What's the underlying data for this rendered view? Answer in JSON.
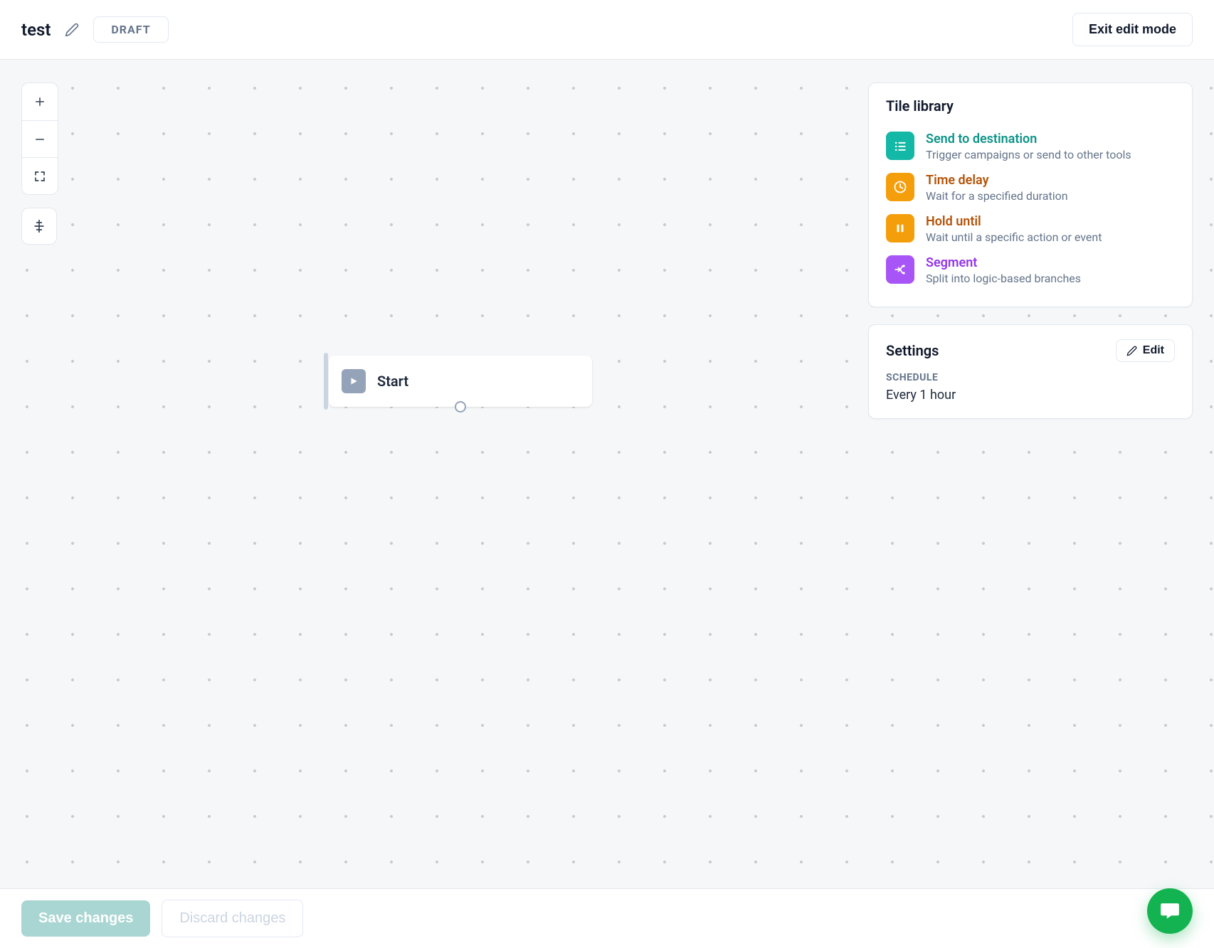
{
  "header": {
    "title": "test",
    "status_badge": "DRAFT",
    "exit_label": "Exit edit mode"
  },
  "canvas": {
    "start_label": "Start"
  },
  "tile_library": {
    "title": "Tile library",
    "tiles": [
      {
        "icon": "list-icon",
        "title": "Send to destination",
        "desc": "Trigger campaigns or send to other tools",
        "icon_color": "c-teal",
        "title_color": "t-teal"
      },
      {
        "icon": "clock-icon",
        "title": "Time delay",
        "desc": "Wait for a specified duration",
        "icon_color": "c-amber",
        "title_color": "t-amber"
      },
      {
        "icon": "pause-icon",
        "title": "Hold until",
        "desc": "Wait until a specific action or event",
        "icon_color": "c-amber2",
        "title_color": "t-amber"
      },
      {
        "icon": "branch-icon",
        "title": "Segment",
        "desc": "Split into logic-based branches",
        "icon_color": "c-purple",
        "title_color": "t-purple"
      }
    ]
  },
  "settings": {
    "title": "Settings",
    "edit_label": "Edit",
    "schedule_label": "SCHEDULE",
    "schedule_value": "Every 1 hour"
  },
  "footer": {
    "save_label": "Save changes",
    "discard_label": "Discard changes"
  }
}
